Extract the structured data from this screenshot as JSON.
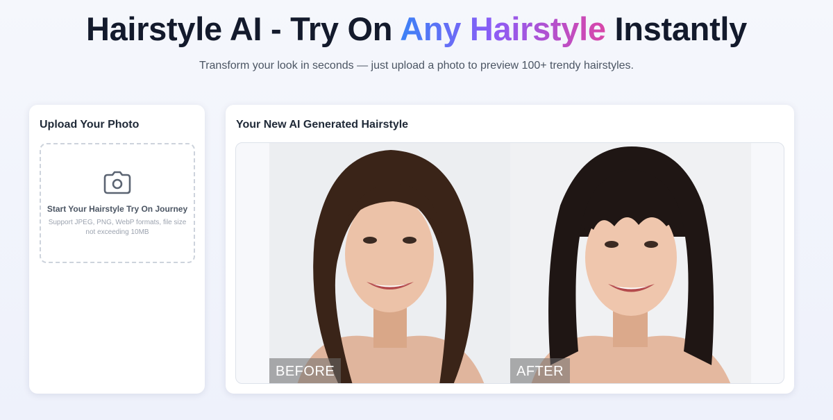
{
  "hero": {
    "title_start": "Hairstyle AI - Try On ",
    "title_highlight": "Any Hairstyle",
    "title_end": " Instantly",
    "subtitle": "Transform your look in seconds — just upload a photo to preview 100+ trendy hairstyles."
  },
  "upload": {
    "title": "Upload Your Photo",
    "drop_title": "Start Your Hairstyle Try On Journey",
    "drop_hint": "Support JPEG, PNG, WebP formats, file size not exceeding 10MB",
    "icon": "camera-icon"
  },
  "result": {
    "title": "Your New AI Generated Hairstyle",
    "before_label": "BEFORE",
    "after_label": "AFTER"
  },
  "colors": {
    "gradient_start": "#3b82f6",
    "gradient_mid": "#8b5cf6",
    "gradient_end": "#d946a8",
    "title_text": "#131a2c"
  }
}
